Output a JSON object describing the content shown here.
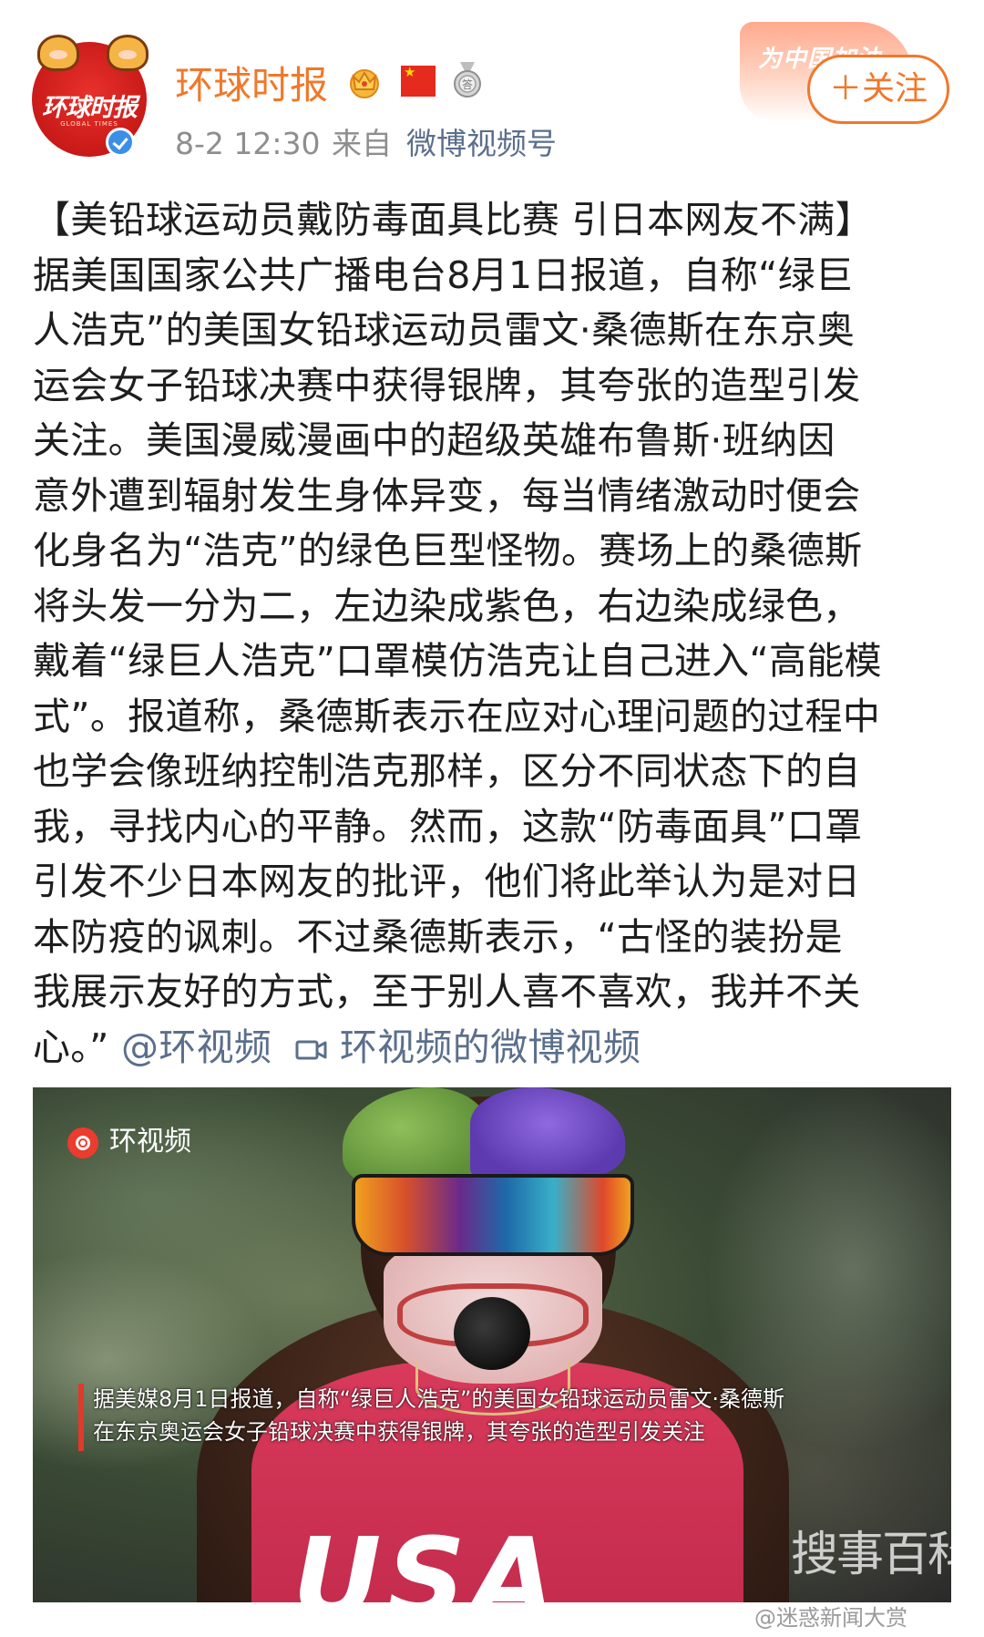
{
  "header": {
    "account_name": "环球时报",
    "avatar_logo_text": "环球时报",
    "avatar_sub_text": "GLOBAL TIMES",
    "post_time": "8-2 12:30",
    "source_prefix": "来自",
    "source_name": "微博视频号",
    "banner_text": "为中国加油",
    "follow_label": "＋关注",
    "icons": [
      "verified-icon",
      "crown-icon",
      "flag-icon",
      "medal-icon"
    ]
  },
  "post": {
    "lines": [
      "【美铅球运动员戴防毒面具比赛 引日本网友不满】",
      "据美国国家公共广播电台8月1日报道，自称“绿巨",
      "人浩克”的美国女铅球运动员雷文·桑德斯在东京奥",
      "运会女子铅球决赛中获得银牌，其夸张的造型引发",
      "关注。美国漫威漫画中的超级英雄布鲁斯·班纳因",
      "意外遭到辐射发生身体异变，每当情绪激动时便会",
      "化身名为“浩克”的绿色巨型怪物。赛场上的桑德斯",
      "将头发一分为二，左边染成紫色，右边染成绿色，",
      "戴着“绿巨人浩克”口罩模仿浩克让自己进入“高能模",
      "式”。报道称，桑德斯表示在应对心理问题的过程中",
      "也学会像班纳控制浩克那样，区分不同状态下的自",
      "我，寻找内心的平静。然而，这款“防毒面具”口罩",
      "引发不少日本网友的批评，他们将此举认为是对日",
      "本防疫的讽刺。不过桑德斯表示，“古怪的装扮是",
      "我展示友好的方式，至于别人喜不喜欢，我并不关"
    ],
    "last_line_text": "心。”",
    "mention": "@环视频",
    "video_link": "环视频的微博视频"
  },
  "video": {
    "source_label": "环视频",
    "caption_line_1": "据美媒8月1日报道，自称“绿巨人浩克”的美国女铅球运动员雷文·桑德斯",
    "caption_line_2": "在东京奥运会女子铅球决赛中获得银牌，其夸张的造型引发关注",
    "jersey_text": "USA",
    "watermark": "搜事百科"
  },
  "footer": {
    "weibo_watermark": "@迷惑新闻大赏"
  },
  "colors": {
    "accent_orange": "#f0782a",
    "link_blue": "#5b6f8c",
    "text": "#1e1e1e",
    "meta_gray": "#8e8e8e"
  }
}
